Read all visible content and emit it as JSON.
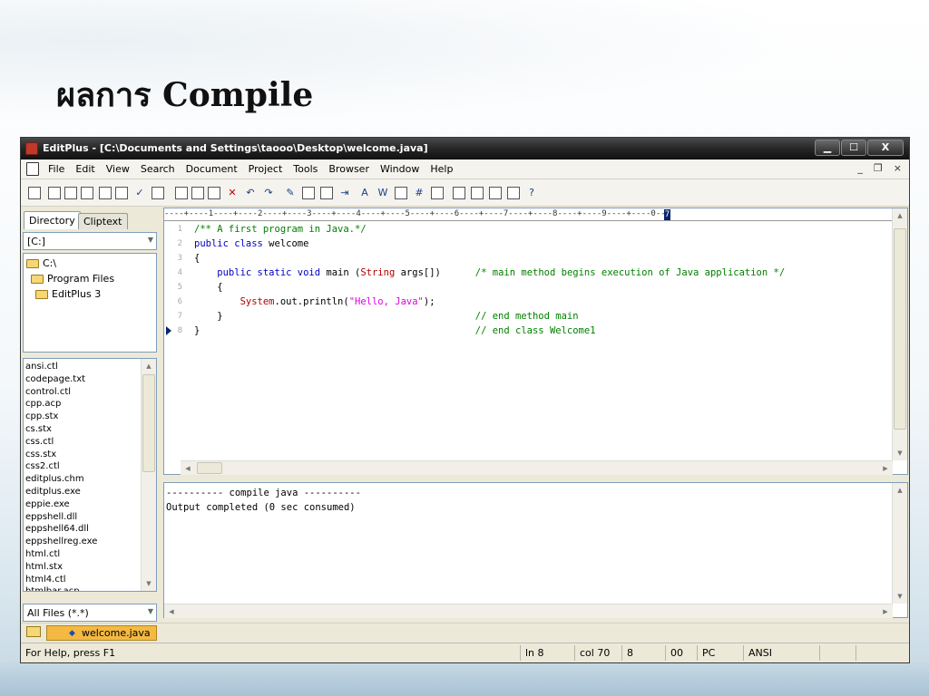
{
  "slide": {
    "title": "ผลการ Compile"
  },
  "window": {
    "title": "EditPlus - [C:\\Documents and Settings\\taooo\\Desktop\\welcome.java]",
    "controls": {
      "minimize": "▁",
      "maximize": "☐",
      "close": "X"
    }
  },
  "menu": {
    "items": [
      "File",
      "Edit",
      "View",
      "Search",
      "Document",
      "Project",
      "Tools",
      "Browser",
      "Window",
      "Help"
    ],
    "mdi_minimize": "_",
    "mdi_restore": "❐",
    "mdi_close": "×"
  },
  "toolbar": {
    "icons": [
      "new-file",
      "open-folder",
      "save",
      "save-all",
      "print-preview",
      "print",
      "spell-check",
      "find",
      "cut",
      "copy",
      "paste",
      "delete",
      "undo",
      "redo",
      "highlighter",
      "replace",
      "word-wrap",
      "indent",
      "font",
      "bold",
      "line-numbers",
      "hex",
      "settings",
      "screen-split",
      "view-right",
      "cliptext",
      "window",
      "help-pointer"
    ]
  },
  "left_panel": {
    "tabs": [
      "Directory",
      "Cliptext"
    ],
    "drive": "[C:]",
    "tree": [
      "C:\\",
      "Program Files",
      "EditPlus 3"
    ],
    "files": [
      "ansi.ctl",
      "codepage.txt",
      "control.ctl",
      "cpp.acp",
      "cpp.stx",
      "cs.stx",
      "css.ctl",
      "css.stx",
      "css2.ctl",
      "editplus.chm",
      "editplus.exe",
      "eppie.exe",
      "eppshell.dll",
      "eppshell64.dll",
      "eppshellreg.exe",
      "html.ctl",
      "html.stx",
      "html4.ctl",
      "htmlbar.acp"
    ],
    "filter": "All Files (*.*)"
  },
  "editor": {
    "ruler": "----+----1----+----2----+----3----+----4----+----5----+----6----+----7----+----8----+----9----+----0---",
    "ruler_mark": "7",
    "line_numbers": [
      "1",
      "2",
      "3",
      "4",
      "5",
      "6",
      "7",
      "8"
    ],
    "lines": [
      {
        "parts": [
          {
            "t": "/** A first program in Java.*/",
            "c": "comment"
          }
        ]
      },
      {
        "parts": [
          {
            "t": "public class",
            "c": "keyword"
          },
          {
            "t": " welcome",
            "c": ""
          }
        ]
      },
      {
        "parts": [
          {
            "t": "{",
            "c": ""
          }
        ]
      },
      {
        "parts": [
          {
            "t": "    public static void",
            "c": "keyword"
          },
          {
            "t": " main (",
            "c": ""
          },
          {
            "t": "String",
            "c": "type"
          },
          {
            "t": " args[])      ",
            "c": ""
          },
          {
            "t": "/* main method begins execution of Java application */",
            "c": "comment"
          }
        ]
      },
      {
        "parts": [
          {
            "t": "    {",
            "c": ""
          }
        ]
      },
      {
        "parts": [
          {
            "t": "        ",
            "c": ""
          },
          {
            "t": "System",
            "c": "type"
          },
          {
            "t": ".out.println(",
            "c": ""
          },
          {
            "t": "\"Hello, Java\"",
            "c": "string"
          },
          {
            "t": ");",
            "c": ""
          }
        ]
      },
      {
        "parts": [
          {
            "t": "    }                                            ",
            "c": ""
          },
          {
            "t": "// end method main",
            "c": "comment"
          }
        ]
      },
      {
        "parts": [
          {
            "t": "}                                                ",
            "c": ""
          },
          {
            "t": "// end class Welcome1",
            "c": "comment"
          }
        ]
      }
    ]
  },
  "output": {
    "lines": [
      "---------- compile java ----------",
      "Output completed (0 sec consumed)"
    ]
  },
  "doc_tabs": {
    "active": "welcome.java"
  },
  "status": {
    "help": "For Help, press F1",
    "line": "ln 8",
    "col": "col 70",
    "num": "8",
    "code": "00",
    "mode": "PC",
    "encoding": "ANSI"
  },
  "colors": {
    "comment": "#008000",
    "keyword": "#0000c0",
    "string": "#e000e0",
    "type": "#b00000",
    "titlebar": "#262626",
    "active_tab": "#f4b942"
  }
}
